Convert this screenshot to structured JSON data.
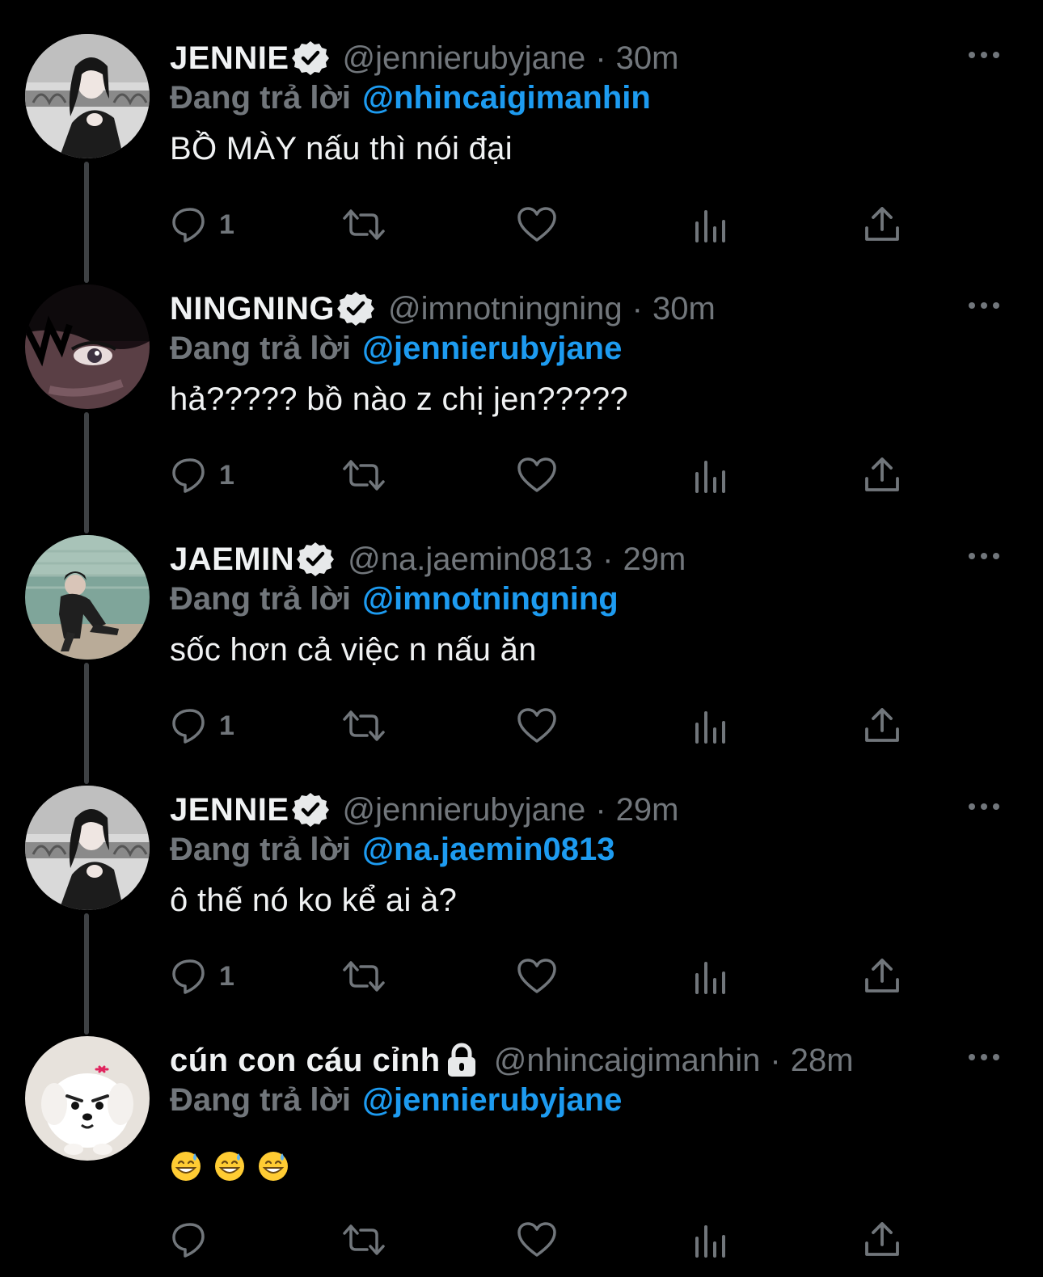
{
  "reply_prefix": "Đang trả lời",
  "more_icon": "more-horizontal-icon",
  "colors": {
    "background": "#000000",
    "secondary_text": "#71767b",
    "link": "#1d9bf0",
    "thread_line": "#3e4144"
  },
  "tweets": [
    {
      "display_name": "JENNIE",
      "badge": "verified-badge-icon",
      "handle": "@jennierubyjane",
      "time": "30m",
      "reply_to": "@nhincaigimanhin",
      "text": "BỒ MÀY nấu thì nói đại",
      "reply_count": "1"
    },
    {
      "display_name": "NINGNING",
      "badge": "verified-badge-icon",
      "handle": "@imnotningning",
      "time": "30m",
      "reply_to": "@jennierubyjane",
      "text": "hả????? bồ nào z chị jen?????",
      "reply_count": "1"
    },
    {
      "display_name": "JAEMIN",
      "badge": "verified-badge-icon",
      "handle": "@na.jaemin0813",
      "time": "29m",
      "reply_to": "@imnotningning",
      "text": "sốc hơn cả việc n nấu ăn",
      "reply_count": "1"
    },
    {
      "display_name": "JENNIE",
      "badge": "verified-badge-icon",
      "handle": "@jennierubyjane",
      "time": "29m",
      "reply_to": "@na.jaemin0813",
      "text": "ô thế nó ko kể ai à?",
      "reply_count": "1"
    },
    {
      "display_name": "cún con cáu cỉnh",
      "badge": "lock-icon",
      "handle": "@nhincaigimanhin",
      "time": "28m",
      "reply_to": "@jennierubyjane",
      "text": "",
      "emojis": [
        "grinning-sweat-emoji",
        "grinning-sweat-emoji",
        "grinning-sweat-emoji"
      ],
      "reply_count": ""
    }
  ]
}
